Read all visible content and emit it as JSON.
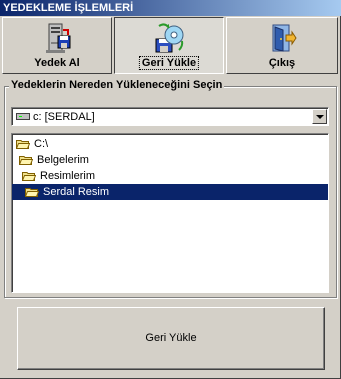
{
  "window": {
    "title": "YEDEKLEME İŞLEMLERİ"
  },
  "toolbar": {
    "buttons": [
      {
        "label": "Yedek Al",
        "icon": "computer-floppy-icon",
        "pressed": false
      },
      {
        "label": "Geri Yükle",
        "icon": "restore-cd-icon",
        "pressed": true
      },
      {
        "label": "Çıkış",
        "icon": "exit-door-icon",
        "pressed": false
      }
    ]
  },
  "source_group": {
    "legend": "Yedeklerin Nereden Yükleneceğini Seçin",
    "drive_select": {
      "value": "c: [SERDAL]",
      "icon": "drive-icon"
    },
    "folder_tree": [
      {
        "label": "C:\\",
        "level": 0,
        "icon": "open-folder-icon",
        "selected": false
      },
      {
        "label": "Belgelerim",
        "level": 1,
        "icon": "open-folder-icon",
        "selected": false
      },
      {
        "label": "Resimlerim",
        "level": 2,
        "icon": "open-folder-icon",
        "selected": false
      },
      {
        "label": "Serdal Resim",
        "level": 3,
        "icon": "open-folder-icon",
        "selected": true
      }
    ]
  },
  "action_button": {
    "label": "Geri Yükle"
  },
  "colors": {
    "titlebar": "#0a246a",
    "selection": "#0a246a",
    "face": "#d4d0c8"
  }
}
